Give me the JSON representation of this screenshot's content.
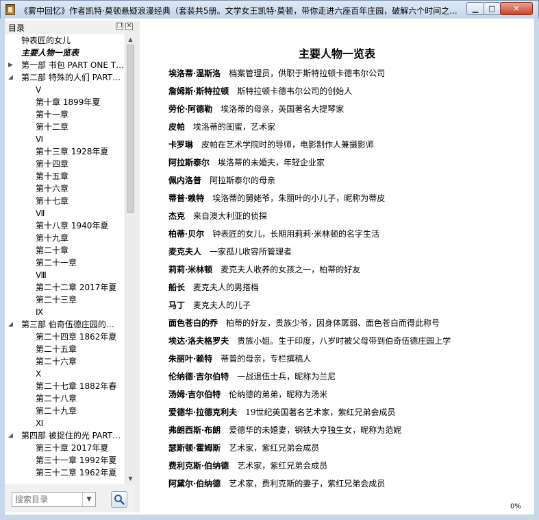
{
  "window": {
    "title": "《雾中回忆》作者凯特·莫顿悬疑浪漫经典（套装共5册。文学女王凯特·莫顿，带你走进六座百年庄园，破解六个时间之...",
    "min_label": "▁",
    "max_label": "□",
    "close_label": "✕"
  },
  "sidebar": {
    "title": "目录",
    "restore_label": "❐",
    "close_label": "✕",
    "search_placeholder": "搜索目录",
    "items": [
      {
        "label": "钟表匠的女儿",
        "level": 1,
        "arrow": ""
      },
      {
        "label": "主要人物一览表",
        "level": 1,
        "arrow": "",
        "active": true
      },
      {
        "label": "第一部 书包 PART ONE T…",
        "level": 1,
        "arrow": "▶"
      },
      {
        "label": "第二部 特殊的人们 PART…",
        "level": 1,
        "arrow": "◢"
      },
      {
        "label": "Ⅴ",
        "level": 2,
        "arrow": ""
      },
      {
        "label": "第十章 1899年夏",
        "level": 2,
        "arrow": ""
      },
      {
        "label": "第十一章",
        "level": 2,
        "arrow": ""
      },
      {
        "label": "第十二章",
        "level": 2,
        "arrow": ""
      },
      {
        "label": "Ⅵ",
        "level": 2,
        "arrow": ""
      },
      {
        "label": "第十三章 1928年夏",
        "level": 2,
        "arrow": ""
      },
      {
        "label": "第十四章",
        "level": 2,
        "arrow": ""
      },
      {
        "label": "第十五章",
        "level": 2,
        "arrow": ""
      },
      {
        "label": "第十六章",
        "level": 2,
        "arrow": ""
      },
      {
        "label": "第十七章",
        "level": 2,
        "arrow": ""
      },
      {
        "label": "Ⅶ",
        "level": 2,
        "arrow": ""
      },
      {
        "label": "第十八章 1940年夏",
        "level": 2,
        "arrow": ""
      },
      {
        "label": "第十九章",
        "level": 2,
        "arrow": ""
      },
      {
        "label": "第二十章",
        "level": 2,
        "arrow": ""
      },
      {
        "label": "第二十一章",
        "level": 2,
        "arrow": ""
      },
      {
        "label": "Ⅷ",
        "level": 2,
        "arrow": ""
      },
      {
        "label": "第二十二章 2017年夏",
        "level": 2,
        "arrow": ""
      },
      {
        "label": "第二十三章",
        "level": 2,
        "arrow": ""
      },
      {
        "label": "Ⅸ",
        "level": 2,
        "arrow": ""
      },
      {
        "label": "第三部 伯奇伍德庄园的…",
        "level": 1,
        "arrow": "◢"
      },
      {
        "label": "第二十四章 1862年夏",
        "level": 2,
        "arrow": ""
      },
      {
        "label": "第二十五章",
        "level": 2,
        "arrow": ""
      },
      {
        "label": "第二十六章",
        "level": 2,
        "arrow": ""
      },
      {
        "label": "Ⅹ",
        "level": 2,
        "arrow": ""
      },
      {
        "label": "第二十七章 1882年春",
        "level": 2,
        "arrow": ""
      },
      {
        "label": "第二十八章",
        "level": 2,
        "arrow": ""
      },
      {
        "label": "第二十九章",
        "level": 2,
        "arrow": ""
      },
      {
        "label": "Ⅺ",
        "level": 2,
        "arrow": ""
      },
      {
        "label": "第四部 被捉住的光 PART…",
        "level": 1,
        "arrow": "◢"
      },
      {
        "label": "第三十章 2017年夏",
        "level": 2,
        "arrow": ""
      },
      {
        "label": "第三十一章 1992年夏",
        "level": 2,
        "arrow": ""
      },
      {
        "label": "第三十二章 1962年夏",
        "level": 2,
        "arrow": ""
      }
    ]
  },
  "document": {
    "title": "主要人物一览表",
    "zoom": "0%",
    "entries": [
      {
        "name": "埃洛蒂·温斯洛",
        "desc": "档案管理员，供职于斯特拉顿卡德韦尔公司"
      },
      {
        "name": "詹姆斯·斯特拉顿",
        "desc": "斯特拉顿卡德韦尔公司的创始人"
      },
      {
        "name": "劳伦·阿德勒",
        "desc": "埃洛蒂的母亲，英国著名大提琴家"
      },
      {
        "name": "皮帕",
        "desc": "埃洛蒂的闺蜜，艺术家"
      },
      {
        "name": "卡罗琳",
        "desc": "皮帕在艺术学院时的导师，电影制作人兼摄影师"
      },
      {
        "name": "阿拉斯泰尔",
        "desc": "埃洛蒂的未婚夫，年轻企业家"
      },
      {
        "name": "佩内洛普",
        "desc": "阿拉斯泰尔的母亲"
      },
      {
        "name": "蒂普·赖特",
        "desc": "埃洛蒂的舅姥爷，朱丽叶的小儿子，昵称为蒂皮"
      },
      {
        "name": "杰克",
        "desc": "来自澳大利亚的侦探"
      },
      {
        "name": "柏蒂·贝尔",
        "desc": "钟表匠的女儿，长期用莉莉·米林顿的名字生活"
      },
      {
        "name": "麦克夫人",
        "desc": "一家孤儿收容所管理者"
      },
      {
        "name": "莉莉·米林顿",
        "desc": "麦克夫人收养的女孩之一，柏蒂的好友"
      },
      {
        "name": "船长",
        "desc": "麦克夫人的男搭档"
      },
      {
        "name": "马丁",
        "desc": "麦克夫人的儿子"
      },
      {
        "name": "面色苍白的乔",
        "desc": "柏蒂的好友，贵族少爷，因身体孱弱、面色苍白而得此称号"
      },
      {
        "name": "埃达·洛夫格罗夫",
        "desc": "贵族小姐。生于印度，八岁时被父母带到伯奇伍德庄园上学"
      },
      {
        "name": "朱丽叶·赖特",
        "desc": "蒂普的母亲，专栏撰稿人"
      },
      {
        "name": "伦纳德·吉尔伯特",
        "desc": "一战退伍士兵，昵称为兰尼"
      },
      {
        "name": "汤姆·吉尔伯特",
        "desc": "伦纳德的弟弟，昵称为汤米"
      },
      {
        "name": "爱德华·拉德克利夫",
        "desc": "19世纪英国著名艺术家，紫红兄弟会成员"
      },
      {
        "name": "弗朗西斯·布朗",
        "desc": "爱德华的未婚妻，钢铁大亨独生女，昵称为范妮"
      },
      {
        "name": "瑟斯顿·霍姆斯",
        "desc": "艺术家，紫红兄弟会成员"
      },
      {
        "name": "费利克斯·伯纳德",
        "desc": "艺术家，紫红兄弟会成员"
      },
      {
        "name": "阿黛尔·伯纳德",
        "desc": "艺术家，费利克斯的妻子，紫红兄弟会成员"
      }
    ]
  }
}
